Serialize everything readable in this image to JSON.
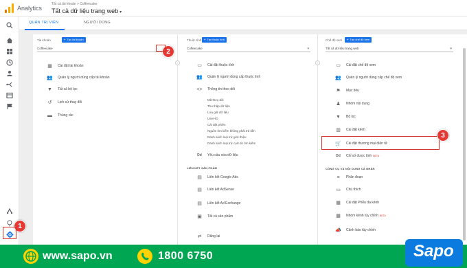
{
  "header": {
    "app_name": "Analytics",
    "breadcrumb": "Tất cả tài khoản > Coffeecake",
    "view_title": "Tất cả dữ liệu trang web",
    "view_caret": "▾"
  },
  "tabs": [
    {
      "label": "QUẢN TRỊ VIÊN",
      "active": true
    },
    {
      "label": "NGƯỜI DÙNG",
      "active": false
    }
  ],
  "columns": {
    "account": {
      "heading": "Tài khoản",
      "create_label": "Tạo tài khoản",
      "selected": "Coffeecake",
      "items": [
        {
          "icon": "building-icon",
          "label": "Cài đặt tài khoản"
        },
        {
          "icon": "people-icon",
          "label": "Quản lý người dùng cấp tài khoản"
        },
        {
          "icon": "filter-icon",
          "label": "Tất cả bộ lọc"
        },
        {
          "icon": "history-icon",
          "label": "Lịch sử thay đổi"
        },
        {
          "icon": "trash-icon",
          "label": "Thùng rác"
        }
      ]
    },
    "property": {
      "heading": "Thuộc tính",
      "create_label": "Tạo thuộc tính",
      "selected": "Coffeecake",
      "items": [
        {
          "icon": "settings-page-icon",
          "label": "Cài đặt thuộc tính"
        },
        {
          "icon": "people-icon",
          "label": "Quản lý người dùng cấp thuộc tính"
        },
        {
          "icon": "code-icon",
          "label": "Thông tin theo dõi"
        }
      ],
      "tracking_sub": [
        "Mã theo dõi",
        "Thu thập dữ liệu",
        "Lưu giữ dữ liệu",
        "User-ID",
        "Cài đặt phiên",
        "Nguồn tìm kiếm không phải trả tiền",
        "Danh sách loại trừ giới thiệu",
        "Danh sách loại trừ cụm từ tìm kiếm"
      ],
      "delete_request": "Yêu cầu xóa dữ liệu",
      "linking_heading": "LIÊN KẾT SẢN PHẨM",
      "links": [
        {
          "icon": "ads-link-icon",
          "label": "Liên kết Google Ads"
        },
        {
          "icon": "adsense-icon",
          "label": "Liên kết AdSense"
        },
        {
          "icon": "ad-exchange-icon",
          "label": "Liên kết Ad Exchange"
        },
        {
          "icon": "all-products-icon",
          "label": "Tất cả sản phẩm"
        }
      ],
      "postbacks": "Dăng lại"
    },
    "view": {
      "heading": "Chế độ xem",
      "create_label": "Tạo chế độ xem",
      "selected": "Tất cả dữ liệu trang web",
      "items": [
        {
          "icon": "settings-page-icon",
          "label": "Cài đặt chế độ xem"
        },
        {
          "icon": "people-icon",
          "label": "Quản lý người dùng cấp chế độ xem"
        },
        {
          "icon": "flag-icon",
          "label": "Mục tiêu"
        },
        {
          "icon": "content-group-icon",
          "label": "Nhóm nội dung"
        },
        {
          "icon": "filter-icon",
          "label": "Bộ lọc"
        },
        {
          "icon": "channel-icon",
          "label": "Cài đặt kênh"
        },
        {
          "icon": "cart-icon",
          "label": "Cài đặt thương mại điện tử"
        },
        {
          "icon": "dd-icon",
          "label": "Chỉ số được tính",
          "beta": "BETA"
        }
      ],
      "personal_heading": "CÔNG CỤ VÀ NỘI DUNG CÁ NHÂN",
      "personal_items": [
        {
          "icon": "segment-icon",
          "label": "Phân đoạn"
        },
        {
          "icon": "annotation-icon",
          "label": "Chú thích"
        },
        {
          "icon": "mcf-icon",
          "label": "Cài đặt Phễu đa kênh"
        },
        {
          "icon": "custom-channel-icon",
          "label": "Nhóm kênh tùy chỉnh",
          "beta": "BETA"
        },
        {
          "icon": "alert-icon",
          "label": "Cảnh báo tùy chỉnh"
        }
      ]
    }
  },
  "steps": [
    "1",
    "2",
    "3"
  ],
  "footer": {
    "website": "www.sapo.vn",
    "phone": "1800 6750",
    "brand": "Sapo"
  },
  "colors": {
    "accent": "#1a73e8",
    "highlight": "#d93025",
    "footer_bg": "#00a651",
    "brand_bg": "#0b7be0"
  }
}
